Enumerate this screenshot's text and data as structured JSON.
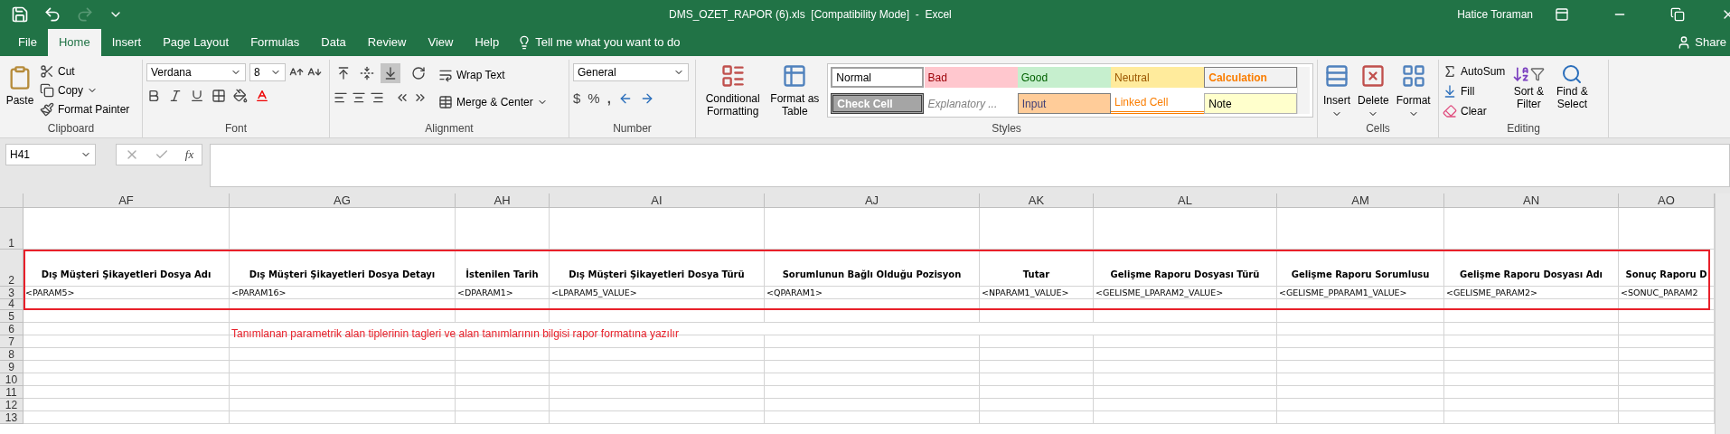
{
  "window": {
    "title": "DMS_OZET_RAPOR (6).xls  [Compatibility Mode]  -  Excel",
    "user": "Hatice Toraman"
  },
  "ribbon_tabs": [
    {
      "label": "File",
      "selected": false
    },
    {
      "label": "Home",
      "selected": true
    },
    {
      "label": "Insert",
      "selected": false
    },
    {
      "label": "Page Layout",
      "selected": false
    },
    {
      "label": "Formulas",
      "selected": false
    },
    {
      "label": "Data",
      "selected": false
    },
    {
      "label": "Review",
      "selected": false
    },
    {
      "label": "View",
      "selected": false
    },
    {
      "label": "Help",
      "selected": false
    }
  ],
  "tell_me": "Tell me what you want to do",
  "share": "Share",
  "clipboard": {
    "label": "Clipboard",
    "paste": "Paste",
    "cut": "Cut",
    "copy": "Copy",
    "format_painter": "Format Painter"
  },
  "font": {
    "label": "Font",
    "font_name": "Verdana",
    "font_size": "8"
  },
  "alignment": {
    "label": "Alignment",
    "wrap_text": "Wrap Text",
    "merge_center": "Merge & Center",
    "vertical_align": [
      {
        "selected": false
      },
      {
        "selected": false
      },
      {
        "selected": true
      }
    ]
  },
  "number": {
    "label": "Number",
    "format": "General",
    "currency": "$",
    "percent": "%",
    "comma": ","
  },
  "styles": {
    "label": "Styles",
    "conditional_formatting": "Conditional Formatting",
    "format_as_table": "Format as Table",
    "cell_styles": [
      {
        "label": "Normal",
        "kind": "normal"
      },
      {
        "label": "Bad",
        "kind": "bad"
      },
      {
        "label": "Good",
        "kind": "good"
      },
      {
        "label": "Neutral",
        "kind": "neutral"
      },
      {
        "label": "Calculation",
        "kind": "calculation"
      },
      {
        "label": "Check Cell",
        "kind": "check"
      },
      {
        "label": "Explanatory ...",
        "kind": "explanatory"
      },
      {
        "label": "Input",
        "kind": "input"
      },
      {
        "label": "Linked Cell",
        "kind": "linked"
      },
      {
        "label": "Note",
        "kind": "note"
      }
    ]
  },
  "cells": {
    "label": "Cells",
    "buttons": [
      "Insert",
      "Delete",
      "Format"
    ]
  },
  "editing": {
    "label": "Editing",
    "autosum": "AutoSum",
    "fill": "Fill",
    "clear": "Clear",
    "sort_filter": "Sort & Filter",
    "find_select": "Find & Select"
  },
  "formula_bar": {
    "name_box": "H41",
    "function_label": "fx"
  },
  "sheet": {
    "columns": [
      "AF",
      "AG",
      "AH",
      "AI",
      "AJ",
      "AK",
      "AL",
      "AM",
      "AN",
      "AO"
    ],
    "rows": [
      "1",
      "2",
      "3",
      "4",
      "5",
      "6",
      "7",
      "8",
      "9",
      "10",
      "11",
      "12",
      "13"
    ],
    "header_row": [
      "Dış Müşteri Şikayetleri Dosya Adı",
      "Dış Müşteri Şikayetleri Dosya Detayı",
      "İstenilen Tarih",
      "Dış Müşteri Şikayetleri Dosya Türü",
      "Sorumlunun Bağlı Olduğu Pozisyon",
      "Tutar",
      "Gelişme Raporu Dosyası Türü",
      "Gelişme Raporu Sorumlusu",
      "Gelişme Raporu Dosyası Adı",
      "Sonuç Raporu D"
    ],
    "tag_row": [
      "<PARAM5>",
      "<PARAM16>",
      "<DPARAM1>",
      "<LPARAM5_VALUE>",
      "<QPARAM1>",
      "<NPARAM1_VALUE>",
      "<GELISME_LPARAM2_VALUE>",
      "<GELISME_PPARAM1_VALUE>",
      "<GELISME_PARAM2>",
      "<SONUC_PARAM2"
    ],
    "note": "Tanımlanan parametrik alan tiplerinin tagleri ve alan tanımlarının bilgisi rapor formatına yazılır"
  }
}
